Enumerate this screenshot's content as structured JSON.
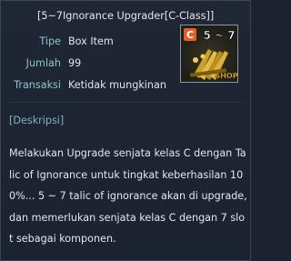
{
  "item": {
    "name": "[5~7Ignorance Upgrader[C-Class]]",
    "grade_badge": "C",
    "icon_range_text": "5 ~ 7",
    "icon_shop_text": "SHOP"
  },
  "properties": [
    {
      "label": "Tipe",
      "value": "Box Item"
    },
    {
      "label": "Jumlah",
      "value": "99"
    },
    {
      "label": "Transaksi",
      "value": "Ketidak mungkinan"
    }
  ],
  "description": {
    "heading": "[Deskripsi]",
    "text": "Melakukan Upgrade senjata kelas C dengan Talic of Ignorance untuk tingkat keberhasilan 100%... 5 ~ 7 talic of ignorance akan di upgrade, dan memerlukan senjata kelas C dengan 7 slot sebagai komponen."
  },
  "colors": {
    "label": "#8ec2d2",
    "value": "#e3e6eb",
    "heading": "#7fb0c3",
    "badge": "#e0622a",
    "icon_text": "#ffffff",
    "shop_text": "#f0c23a"
  },
  "icons": {
    "item": "ignorance-upgrader-icon",
    "grade": "c-grade-badge-icon"
  }
}
